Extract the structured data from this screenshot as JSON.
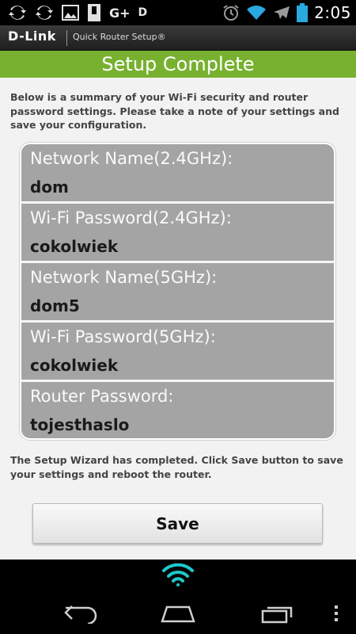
{
  "status_bar": {
    "left_icons": [
      "sync-icon",
      "sync-icon",
      "image-icon",
      "usb-icon"
    ],
    "google_plus_text": "G+",
    "d_text": "D",
    "right_icons": [
      "alarm-icon",
      "wifi-icon",
      "airplane-icon",
      "battery-icon"
    ],
    "time": "2:05"
  },
  "app_header": {
    "brand": "D-Link",
    "app_name": "Quick Router Setup®"
  },
  "title": "Setup Complete",
  "intro_text": "Below is a summary of your Wi-Fi security and router password settings. Please take a note of your settings and save your configuration.",
  "summary": {
    "rows": [
      {
        "label": "Network Name(2.4GHz):",
        "value": "dom"
      },
      {
        "label": "Wi-Fi Password(2.4GHz):",
        "value": "cokolwiek"
      },
      {
        "label": "Network Name(5GHz):",
        "value": "dom5"
      },
      {
        "label": "Wi-Fi Password(5GHz):",
        "value": "cokolwiek"
      },
      {
        "label": "Router Password:",
        "value": "tojesthaslo"
      }
    ]
  },
  "outro_text": "The Setup Wizard has completed. Click Save button to save your settings and reboot the router.",
  "save_button_label": "Save",
  "colors": {
    "accent_green": "#78b130",
    "wifi_teal": "#1ec8c8",
    "summary_bg": "#a4a4a4"
  },
  "nav_bar": {
    "icons": [
      "wifi-icon",
      "back-icon",
      "home-icon",
      "recent-apps-icon",
      "menu-icon"
    ]
  }
}
